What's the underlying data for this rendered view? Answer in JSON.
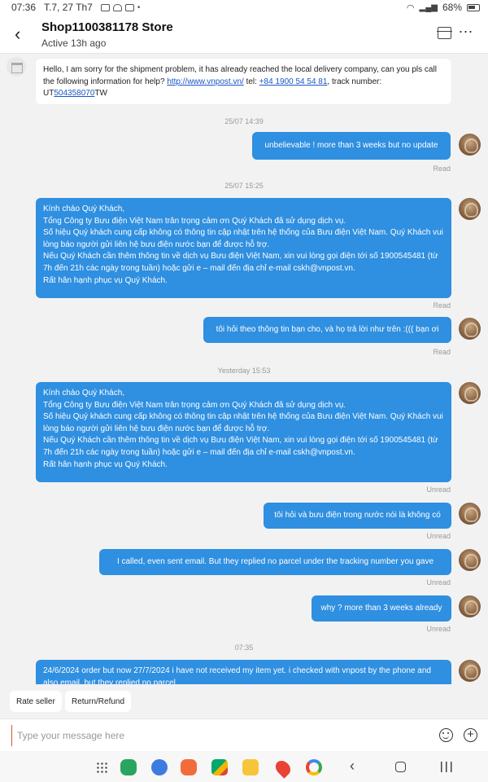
{
  "status_bar": {
    "time": "07:36",
    "date": "T.7, 27 Th7",
    "battery": "68%"
  },
  "header": {
    "shop_name": "Shop1100381178 Store",
    "status": "Active 13h ago"
  },
  "messages": {
    "m0": {
      "part1": "Hello, I am sorry for the shipment problem, it has already reached the local delivery company, can you pls call the following information for help? ",
      "link1": "http://www.vnpost.vn/",
      "part2": "  tel: ",
      "phone": "+84 1900 54 54 81",
      "part3": ", track number: UT",
      "tracking_link": "504358070",
      "part4": "TW"
    },
    "ts1": "25/07 14:39",
    "m1": "unbelievable ! more than 3 weeks but no update",
    "r1": "Read",
    "ts2": "25/07 15:25",
    "m2": {
      "l1": "Kính chào Quý Khách,",
      "l2": "Tổng Công ty Bưu điện Việt Nam trân trọng cảm ơn Quý Khách đã sử dụng dịch vụ.",
      "l3": " Số hiệu Quý khách cung cấp không có thông tin cập nhật trên hệ thống của Bưu điện Việt Nam. Quý Khách vui lòng báo người gửi liên hệ bưu điện nước bạn để được hỗ trợ.",
      "l4": "Nếu Quý Khách cần thêm thông tin về dịch vụ Bưu điện Việt Nam, xin vui lòng gọi điện tới số 1900545481 (từ 7h đến 21h các ngày trong tuần) hoặc gửi e – mail đến địa chỉ e-mail cskh@vnpost.vn.",
      "l5": "Rất hân hạnh phục vụ Quý Khách."
    },
    "r2": "Read",
    "m3": "tôi hỏi theo thông tin bạn cho, và họ trả lời như trên :((( bạn ơi",
    "r3": "Read",
    "ts3": "Yesterday 15:53",
    "m4": {
      "l1": "Kính chào Quý Khách,",
      "l2": "Tổng Công ty Bưu điện Việt Nam trân trọng cảm ơn Quý Khách đã sử dụng dịch vụ.",
      "l3": " Số hiệu Quý khách cung cấp không có thông tin cập nhật trên hệ thống của Bưu điện Việt Nam. Quý Khách vui lòng báo người gửi liên hệ bưu điện nước bạn để được hỗ trợ.",
      "l4": "Nếu Quý Khách cần thêm thông tin về dịch vụ Bưu điện Việt Nam, xin vui lòng gọi điện tới số 1900545481 (từ 7h đến 21h các ngày trong tuần) hoặc gửi e – mail đến địa chỉ e-mail cskh@vnpost.vn.",
      "l5": "Rất hân hạnh phục vụ Quý Khách."
    },
    "r4": "Unread",
    "m5": "tôi hỏi và bưu điện trong nước nói là không có",
    "r5": "Unread",
    "m6": "I called, even sent email. But they replied no parcel under the tracking number you gave",
    "r6": "Unread",
    "m7": "why ? more than 3 weeks already",
    "r7": "Unread",
    "ts4": "07:35",
    "m8": "24/6/2024 order but now 27/7/2024 i have not received my item yet.  i checked with vnpost by the phone and also email, but they replied no parcel"
  },
  "quick_replies": [
    "Rate seller",
    "Return/Refund"
  ],
  "composer": {
    "placeholder": "Type your message here"
  },
  "nav_apps": [
    "phone",
    "messages",
    "contacts",
    "meet",
    "files",
    "maps",
    "google"
  ],
  "colors": {
    "outgoing_bubble": "#2f8fe0",
    "incoming_bubble": "#ffffff",
    "link": "#1a55c8"
  }
}
